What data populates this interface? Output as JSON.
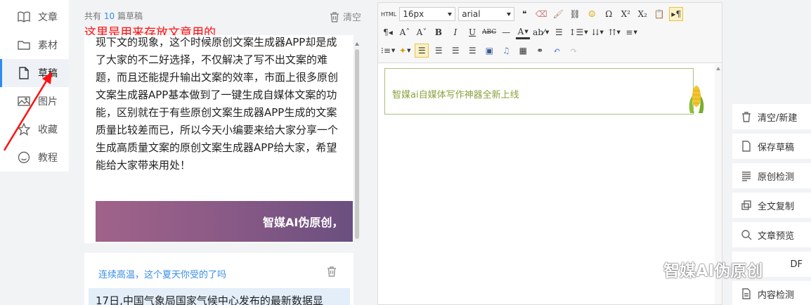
{
  "nav": {
    "items": [
      {
        "label": "文章",
        "icon": "book-icon"
      },
      {
        "label": "素材",
        "icon": "folder-icon"
      },
      {
        "label": "草稿",
        "icon": "file-icon",
        "active": true
      },
      {
        "label": "图片",
        "icon": "image-icon"
      },
      {
        "label": "收藏",
        "icon": "star-icon"
      },
      {
        "label": "教程",
        "icon": "smile-icon"
      }
    ]
  },
  "drafts": {
    "count_prefix": "共有",
    "count": "10",
    "count_suffix": "篇草稿",
    "clear_label": "清空",
    "annotation": "这里是用来存放文章用的",
    "card1_text": "现下文的现象，这个时候原创文案生成器APP却是成了大家的不二好选择，不仅解决了写不出文案的难题，而且还能提升输出文案的效率，市面上很多原创文案生成器APP基本做到了一键生成自媒体文案的功能，区别就在于有些原创文案生成器APP生成的文案质量比较差而已，所以今天小编要来给大家分享一个生成高质量文案的原创文案生成器APP给大家，希望能给大家带来用处！",
    "card1_banner": "智媒AI伪原创，",
    "card2_title": "连续高温，这个夏天你受的了吗",
    "card2_snippet": "17日,中国气象局国家气候中心发布的最新数据显"
  },
  "editor": {
    "html_label": "HTML",
    "font_size": "16px",
    "font_family": "arial",
    "promo_text": "智媒ai自媒体写作神器全新上线"
  },
  "actions": [
    {
      "label": "清空/新建",
      "icon": "trash-icon"
    },
    {
      "label": "保存草稿",
      "icon": "file-icon"
    },
    {
      "label": "原创检测",
      "icon": "lines-icon"
    },
    {
      "label": "全文复制",
      "icon": "copy-icon"
    },
    {
      "label": "文章预览",
      "icon": "search-icon"
    },
    {
      "label": "内容检测",
      "icon": "doc-icon"
    }
  ],
  "watermark": "智媒AI伪原创",
  "watermark_tail": "DF",
  "colors": {
    "annotation": "#ff1010",
    "accent": "#2d8cf0",
    "link": "#3a8ee6",
    "promo": "#8aa23e"
  }
}
